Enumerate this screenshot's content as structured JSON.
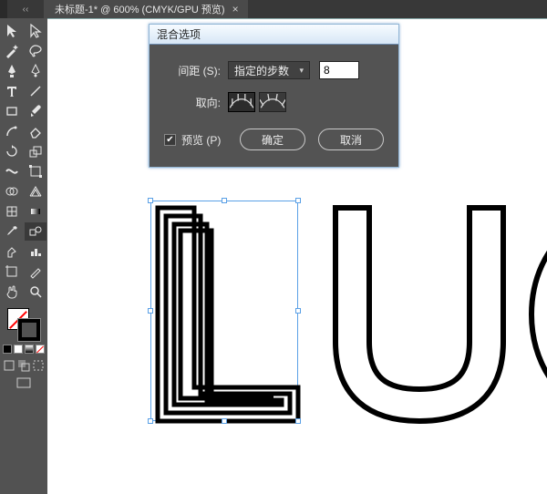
{
  "tab": {
    "title": "未标题-1* @ 600% (CMYK/GPU 预览)",
    "close_glyph": "×"
  },
  "tools": {
    "items": [
      "selection",
      "direct-selection",
      "magic-wand",
      "lasso",
      "pen",
      "curvature-pen",
      "type",
      "line-segment",
      "rectangle",
      "paintbrush",
      "shaper",
      "eraser",
      "rotate",
      "scale",
      "width",
      "free-transform",
      "shape-builder",
      "perspective-grid",
      "mesh",
      "gradient",
      "eyedropper",
      "blend",
      "symbol-sprayer",
      "column-graph",
      "artboard",
      "slice",
      "hand",
      "zoom"
    ]
  },
  "dialog": {
    "title": "混合选项",
    "spacing_label": "间距 (S):",
    "spacing_mode": "指定的步数",
    "spacing_value": "8",
    "orientation_label": "取向:",
    "preview_label": "预览 (P)",
    "ok_label": "确定",
    "cancel_label": "取消"
  },
  "artwork": {
    "text_letters": [
      "L",
      "U",
      "C"
    ]
  }
}
